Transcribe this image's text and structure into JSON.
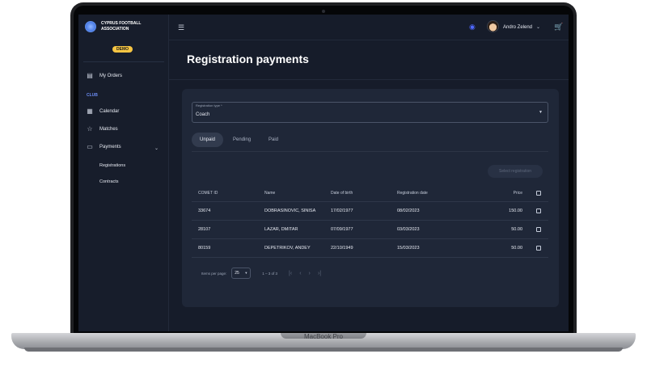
{
  "device": {
    "label": "MacBook Pro"
  },
  "brand": {
    "name": "CYPRUS FOOTBALL ASSOCIATION"
  },
  "badge": {
    "demo": "DEMO"
  },
  "sidebar": {
    "my_orders": "My Orders",
    "section_club": "CLUB",
    "calendar": "Calendar",
    "matches": "Matches",
    "payments": "Payments",
    "registrations": "Registrations",
    "contracts": "Contracts"
  },
  "header": {
    "user_name": "Andro Zelend"
  },
  "page": {
    "title": "Registration payments"
  },
  "registration_type": {
    "label": "Registration type *",
    "value": "Coach"
  },
  "tabs": [
    {
      "label": "Unpaid",
      "active": true
    },
    {
      "label": "Pending",
      "active": false
    },
    {
      "label": "Paid",
      "active": false
    }
  ],
  "actions": {
    "select_registration": "Select registration"
  },
  "table": {
    "columns": {
      "comet_id": "COMET ID",
      "name": "Name",
      "dob": "Date of birth",
      "reg_date": "Registration date",
      "price": "Price"
    },
    "rows": [
      {
        "comet_id": "33674",
        "name": "DOBRASINOVIC, SINISA",
        "dob": "17/02/1977",
        "reg_date": "08/02/2023",
        "price": "150.00"
      },
      {
        "comet_id": "28107",
        "name": "LAZAR, DMITAR",
        "dob": "07/09/1977",
        "reg_date": "03/03/2023",
        "price": "50.00"
      },
      {
        "comet_id": "80159",
        "name": "DEPETRIKOV, ANDEY",
        "dob": "22/10/1949",
        "reg_date": "15/03/2023",
        "price": "50.00"
      }
    ]
  },
  "paginator": {
    "items_per_page_label": "Items per page:",
    "page_size": "25",
    "range": "1 – 3 of 3"
  },
  "colors": {
    "accent": "#4f68ff",
    "badge": "#f6c543",
    "background": "#161c2a",
    "card": "#1f2738"
  }
}
